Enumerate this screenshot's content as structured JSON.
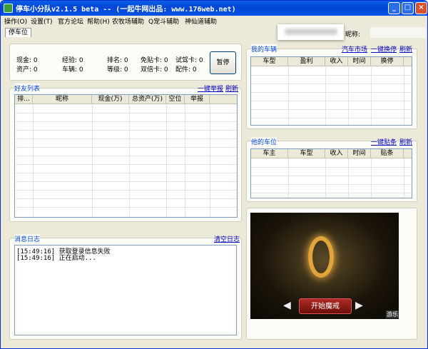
{
  "window": {
    "title": "停车小分队v2.1.5 beta -- (一起牛网出品: www.176web.net)",
    "controls": {
      "minimize": "_",
      "maximize": "□",
      "close": "×"
    }
  },
  "menu": {
    "items": [
      "操作(O)",
      "设置(T)",
      "官方论坛",
      "帮助(H)",
      "农牧场辅助",
      "Q宠斗辅助",
      "神仙道辅助"
    ]
  },
  "tabs": {
    "active": "停车位"
  },
  "header": {
    "nickname_label": "昵称:"
  },
  "stats": {
    "cash": "现金: 0",
    "exp": "经验: 0",
    "rank": "排名: 0",
    "free_card": "免贴卡: 0",
    "test_card": "试驾卡: 0",
    "assets": "资产: 0",
    "cars": "车辆: 0",
    "level": "等级: 0",
    "double_card": "双倍卡: 0",
    "parts": "配件: 0",
    "pause_button": "暂停"
  },
  "friends": {
    "title": "好友列表",
    "report_all": "一键举报",
    "refresh": "刷新",
    "columns": [
      "排...",
      "昵称",
      "现金(万)",
      "总资产(万)",
      "空位",
      "举报"
    ]
  },
  "my_cars": {
    "title": "我的车辆",
    "market": "汽车市场",
    "swap_all": "一键换停",
    "refresh": "刷新",
    "columns": [
      "车型",
      "盈利",
      "收入",
      "时间",
      "换停"
    ]
  },
  "his_slots": {
    "title": "他的车位",
    "post_all": "一键贴条",
    "refresh": "刷新",
    "columns": [
      "车主",
      "车型",
      "收入",
      "时间",
      "贴条"
    ]
  },
  "log": {
    "title": "消息日志",
    "clear": "清空日志",
    "lines": [
      "[15:49:16] 获取登录信息失败",
      "[15:49:16] 正在启动..."
    ]
  },
  "banner": {
    "start_button": "开始魔戒",
    "sound_label": "游乐"
  }
}
